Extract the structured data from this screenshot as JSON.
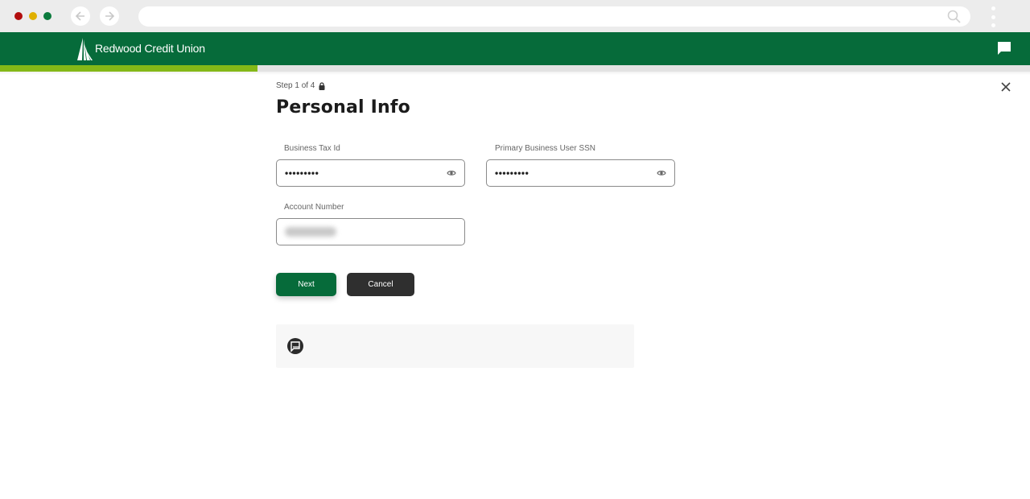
{
  "browser": {
    "icons": {
      "back": "arrow-left-icon",
      "forward": "arrow-right-icon",
      "search": "search-icon",
      "menu": "kebab-menu-icon"
    },
    "address_value": ""
  },
  "header": {
    "brand_name": "Redwood Credit Union",
    "brand_color": "#066b3a",
    "chat_icon": "chat-bubble-icon"
  },
  "progress": {
    "current_step": 1,
    "total_steps": 4,
    "fraction": 0.25,
    "fill_color": "#84b817"
  },
  "form": {
    "step_label": "Step 1 of 4",
    "step_icon": "lock-icon",
    "title": "Personal Info",
    "fields": [
      {
        "label": "Business Tax Id",
        "value": "•••••••••",
        "type": "password",
        "toggle_icon": "eye-icon"
      },
      {
        "label": "Primary Business User SSN",
        "value": "•••••••••",
        "type": "password",
        "toggle_icon": "eye-icon"
      },
      {
        "label": "Account Number",
        "value": "",
        "obscured": true
      }
    ],
    "buttons": {
      "next": "Next",
      "cancel": "Cancel"
    },
    "close_icon": "close-icon"
  },
  "info_panel": {
    "icon": "chat-support-icon",
    "text": ""
  }
}
